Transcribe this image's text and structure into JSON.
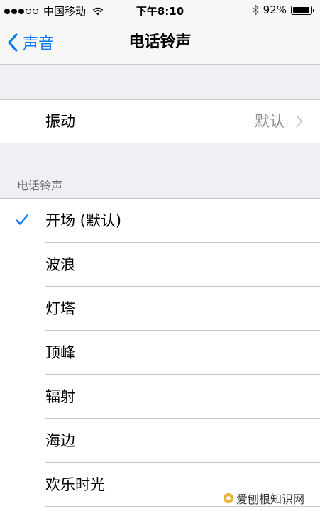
{
  "status_bar": {
    "carrier": "中国移动",
    "time": "下午8:10",
    "battery": "92%",
    "battery_level": 0.92,
    "signal_bars_filled": 3,
    "signal_bars_total": 5
  },
  "nav": {
    "back_label": "声音",
    "title": "电话铃声",
    "accent_color": "#0a7aff"
  },
  "vibration": {
    "label": "振动",
    "value": "默认"
  },
  "ringtones": {
    "section_header": "电话铃声",
    "selected_index": 0,
    "items": [
      {
        "label": "开场 (默认)"
      },
      {
        "label": "波浪"
      },
      {
        "label": "灯塔"
      },
      {
        "label": "顶峰"
      },
      {
        "label": "辐射"
      },
      {
        "label": "海边"
      },
      {
        "label": "欢乐时光"
      }
    ]
  },
  "watermark": {
    "text": "爱刨根知识网"
  },
  "icons": [
    "wifi-icon",
    "bluetooth-icon",
    "battery-icon",
    "chevron-left-icon",
    "chevron-right-icon",
    "checkmark-icon"
  ]
}
